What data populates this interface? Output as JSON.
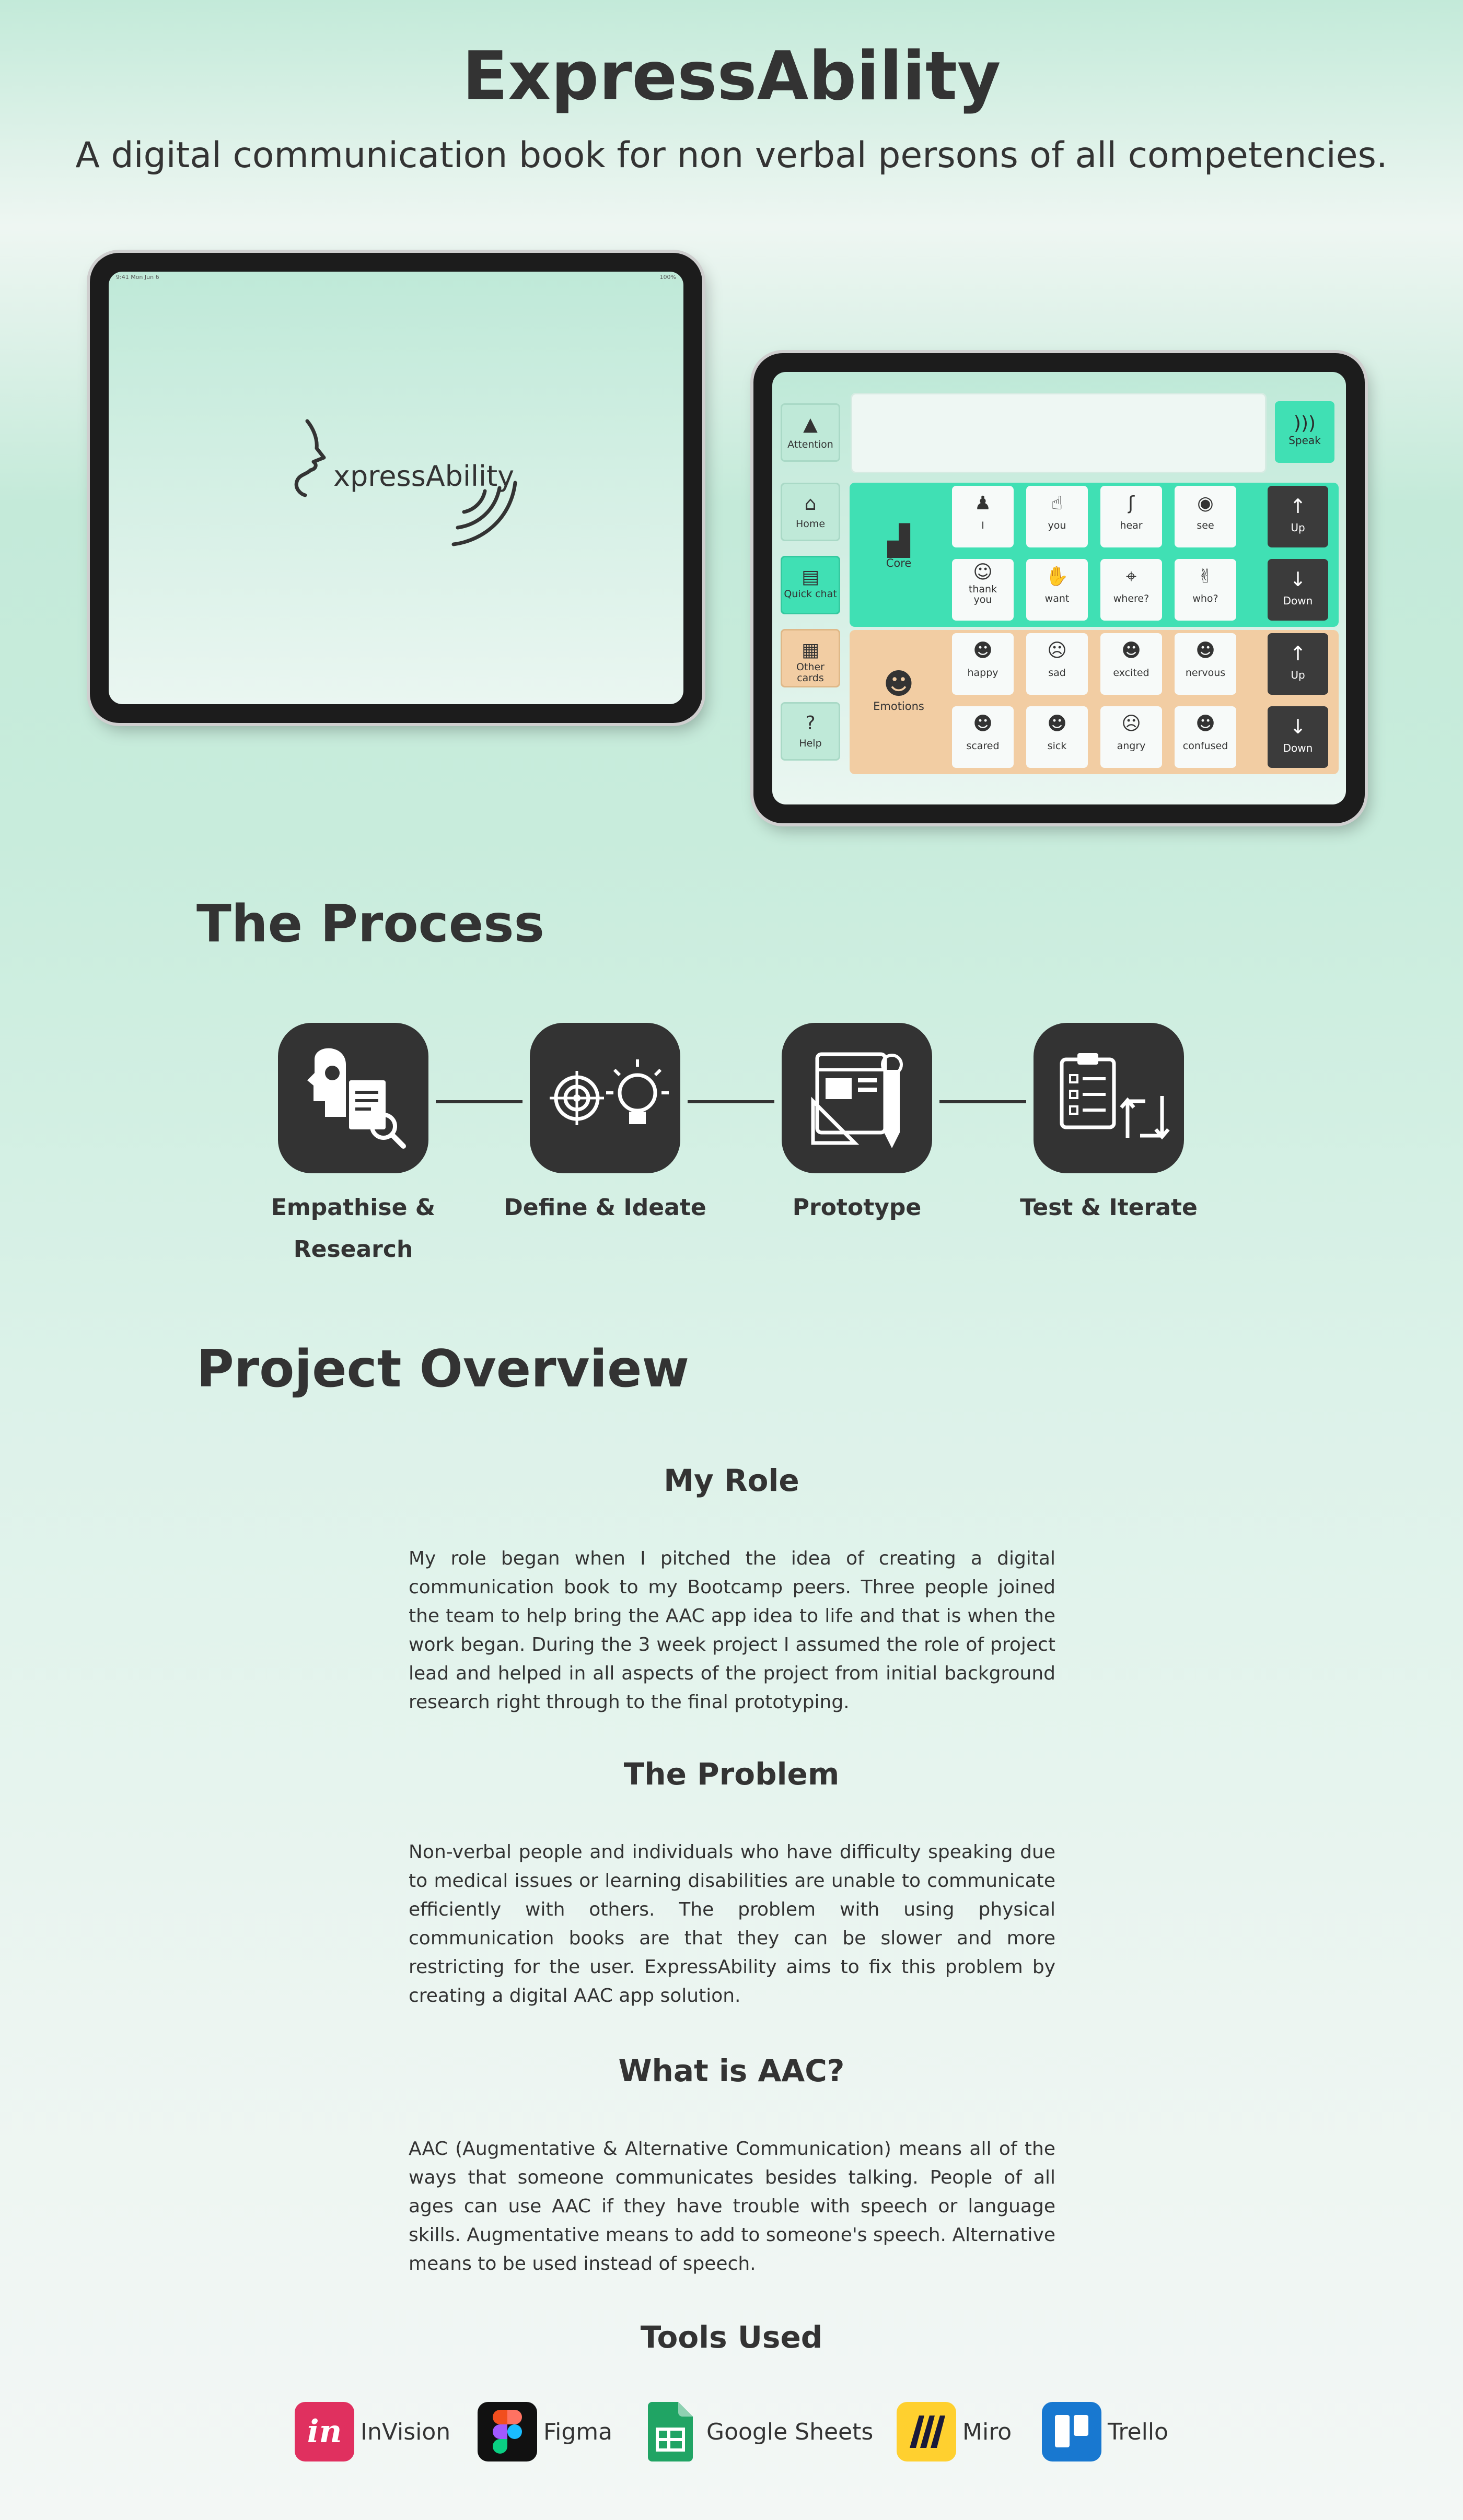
{
  "header": {
    "title": "ExpressAbility",
    "subtitle": "A digital communication book for non verbal persons of all competencies."
  },
  "tablet_splash": {
    "status_left": "9:41  Mon Jun 6",
    "status_right": "100%",
    "logo_text": "xpressAbility"
  },
  "tablet_app": {
    "left_buttons": [
      {
        "icon": "warning-icon",
        "label": "Attention",
        "color": "#bfe9d8"
      },
      {
        "icon": "home-icon",
        "label": "Home",
        "color": "#bfe9d8"
      },
      {
        "icon": "chat-icon",
        "label": "Quick chat",
        "color": "#40e0b4"
      },
      {
        "icon": "cards-icon",
        "label": "Other cards",
        "color": "#f2cda3"
      },
      {
        "icon": "help-icon",
        "label": "Help",
        "color": "#bfe9d8"
      }
    ],
    "speak_label": "Speak",
    "core": {
      "label": "Core",
      "color": "#40e0b4",
      "row1": [
        "I",
        "you",
        "hear",
        "see"
      ],
      "row2": [
        "thank you",
        "want",
        "where?",
        "who?"
      ]
    },
    "emotions": {
      "label": "Emotions",
      "color": "#f2cda3",
      "row1": [
        "happy",
        "sad",
        "excited",
        "nervous"
      ],
      "row2": [
        "scared",
        "sick",
        "angry",
        "confused"
      ]
    },
    "nav": {
      "up": "Up",
      "down": "Down"
    }
  },
  "process": {
    "heading": "The Process",
    "steps": [
      {
        "label": "Empathise & Research",
        "icon": "empathise-research-icon"
      },
      {
        "label": "Define & Ideate",
        "icon": "define-ideate-icon"
      },
      {
        "label": "Prototype",
        "icon": "prototype-icon"
      },
      {
        "label": "Test & Iterate",
        "icon": "test-iterate-icon"
      }
    ]
  },
  "overview": {
    "heading": "Project Overview",
    "role_title": "My Role",
    "role_text": "My role began when I pitched the idea of creating a digital communication book to my Bootcamp peers. Three people joined the team to help bring the AAC app idea to life and that is when the work began. During the 3 week project I assumed the role of project lead and helped in all aspects of the project from initial background research right through to the final prototyping.",
    "problem_title": "The Problem",
    "problem_text": "Non-verbal people and individuals who have difficulty speaking due to medical issues or learning disabilities are unable to communicate efficiently with others. The problem with using physical communication books are that they can be slower and more restricting for the user. ExpressAbility aims to fix this problem by creating a digital AAC app solution.",
    "aac_title": "What is AAC?",
    "aac_text": "AAC (Augmentative & Alternative Communication) means all of the ways that someone communicates besides talking. People of all ages can use AAC if they have trouble with speech or language skills. Augmentative means to add to someone's speech. Alternative means to be used instead of speech."
  },
  "tools": {
    "heading": "Tools Used",
    "items": [
      {
        "name": "InVision",
        "icon": "invision-logo",
        "color": "#e0305f",
        "glyph": "in"
      },
      {
        "name": "Figma",
        "icon": "figma-logo",
        "color": "#111111",
        "glyph": ""
      },
      {
        "name": "Google Sheets",
        "icon": "google-sheets-logo",
        "color": "#20a464",
        "glyph": ""
      },
      {
        "name": "Miro",
        "icon": "miro-logo",
        "color": "#ffd02f",
        "glyph": ""
      },
      {
        "name": "Trello",
        "icon": "trello-logo",
        "color": "#1878d0",
        "glyph": ""
      }
    ]
  }
}
